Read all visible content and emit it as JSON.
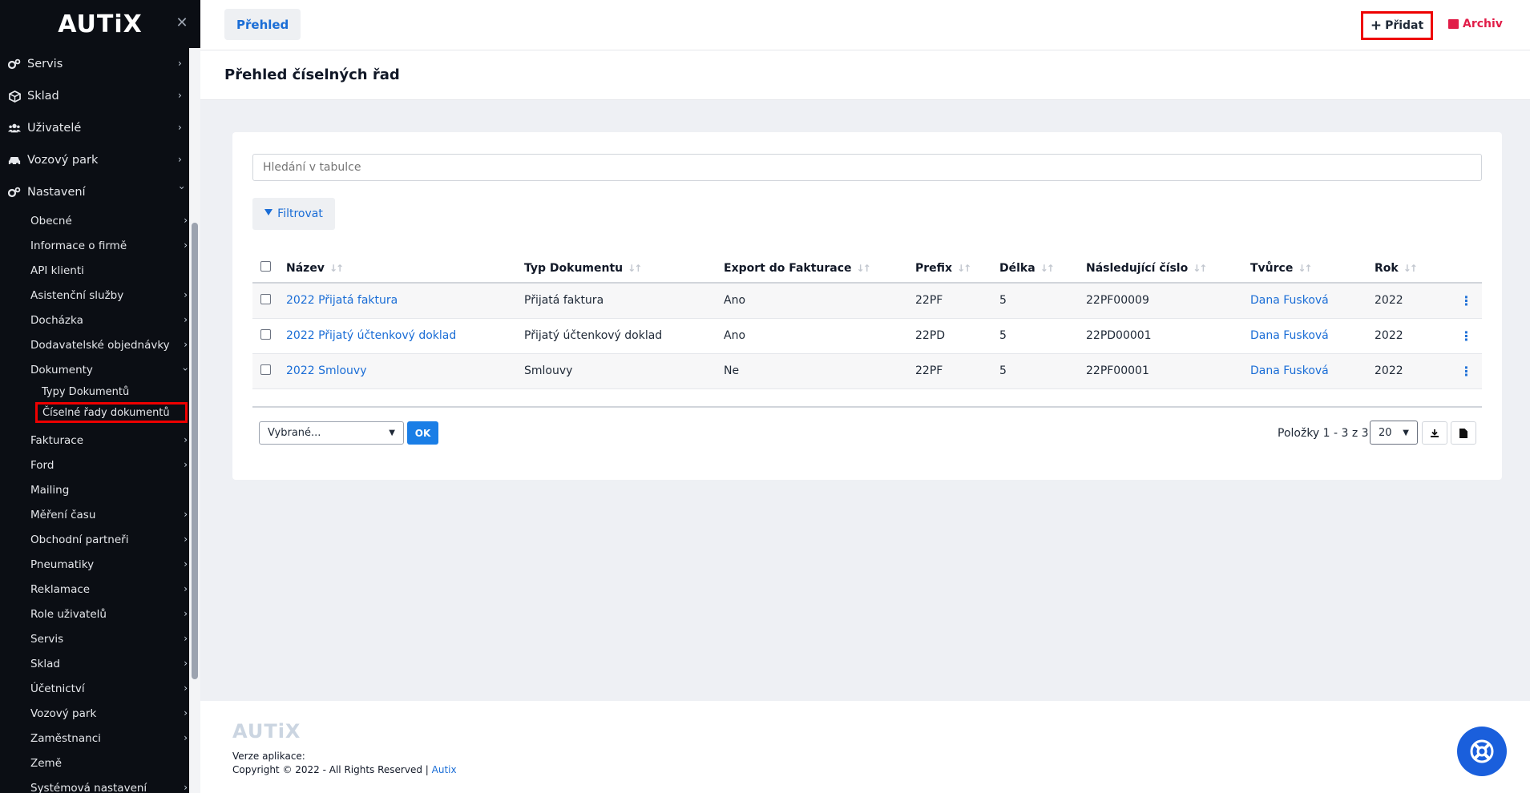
{
  "brand": {
    "logo": "AUTiX"
  },
  "sidebar": {
    "top_items": [
      {
        "label": "Servis",
        "icon": "gears-icon"
      },
      {
        "label": "Sklad",
        "icon": "box-icon"
      },
      {
        "label": "Uživatelé",
        "icon": "users-icon"
      },
      {
        "label": "Vozový park",
        "icon": "car-icon"
      },
      {
        "label": "Nastavení",
        "icon": "gears-icon"
      }
    ],
    "settings_items": [
      "Obecné",
      "Informace o firmě",
      "API klienti",
      "Asistenční služby",
      "Docházka",
      "Dodavatelské objednávky",
      "Dokumenty"
    ],
    "documents_items": [
      "Typy Dokumentů",
      "Číselné řady dokumentů"
    ],
    "settings_items_after": [
      "Fakturace",
      "Ford",
      "Mailing",
      "Měření času",
      "Obchodní partneři",
      "Pneumatiky",
      "Reklamace",
      "Role uživatelů",
      "Servis",
      "Sklad",
      "Účetnictví",
      "Vozový park",
      "Zaměstnanci",
      "Země",
      "Systémová nastavení"
    ]
  },
  "topbar": {
    "tab_label": "Přehled",
    "add_label": "Přidat",
    "archive_label": "Archiv"
  },
  "page": {
    "title": "Přehled číselných řad"
  },
  "search": {
    "placeholder": "Hledání v tabulce"
  },
  "filter": {
    "label": "Filtrovat"
  },
  "table": {
    "columns": [
      "Název",
      "Typ Dokumentu",
      "Export do Fakturace",
      "Prefix",
      "Délka",
      "Následující číslo",
      "Tvůrce",
      "Rok"
    ],
    "rows": [
      [
        "2022 Přijatá faktura",
        "Přijatá faktura",
        "Ano",
        "22PF",
        "5",
        "22PF00009",
        "Dana Fusková",
        "2022"
      ],
      [
        "2022 Přijatý účtenkový doklad",
        "Přijatý účtenkový doklad",
        "Ano",
        "22PD",
        "5",
        "22PD00001",
        "Dana Fusková",
        "2022"
      ],
      [
        "2022 Smlouvy",
        "Smlouvy",
        "Ne",
        "22PF",
        "5",
        "22PF00001",
        "Dana Fusková",
        "2022"
      ]
    ]
  },
  "bulk": {
    "selected": "Vybrané...",
    "ok_label": "OK"
  },
  "pager": {
    "text": "Položky 1 - 3 z 3",
    "per_page": "20"
  },
  "footer": {
    "logo": "AUTiX",
    "version_label": "Verze aplikace:",
    "copyright": "Copyright © 2022 - All Rights Reserved |",
    "link": "Autix"
  },
  "colors": {
    "accent": "#1a6dd6",
    "highlight": "#ee0000",
    "archive": "#e11d48",
    "sidebar": "#0b0e14"
  }
}
